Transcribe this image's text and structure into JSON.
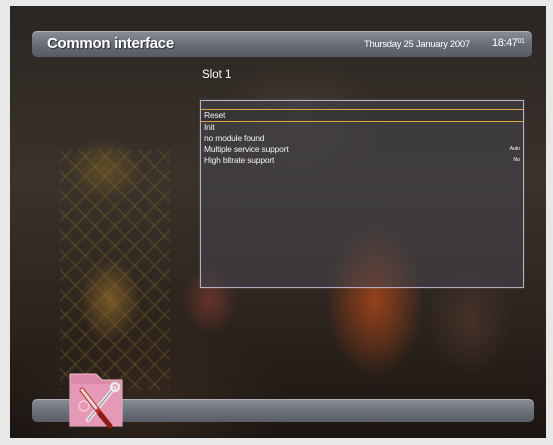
{
  "header": {
    "title": "Common interface",
    "date": "Thursday 25 January 2007",
    "time_hm": "18:47",
    "time_s": "01"
  },
  "slot": {
    "title": "Slot 1"
  },
  "menu": {
    "items": [
      {
        "label": "Reset",
        "value": "",
        "selected": true
      },
      {
        "label": "Init",
        "value": ""
      },
      {
        "label": "no module found",
        "value": ""
      },
      {
        "label": "Multiple service support",
        "value": "Auto"
      },
      {
        "label": "High bitrate support",
        "value": "No"
      }
    ]
  },
  "icons": {
    "tools": "tools-icon"
  },
  "colors": {
    "selection_border": "#e0a83a",
    "panel_border": "#b9aec3",
    "bar": "#6a6e78"
  }
}
